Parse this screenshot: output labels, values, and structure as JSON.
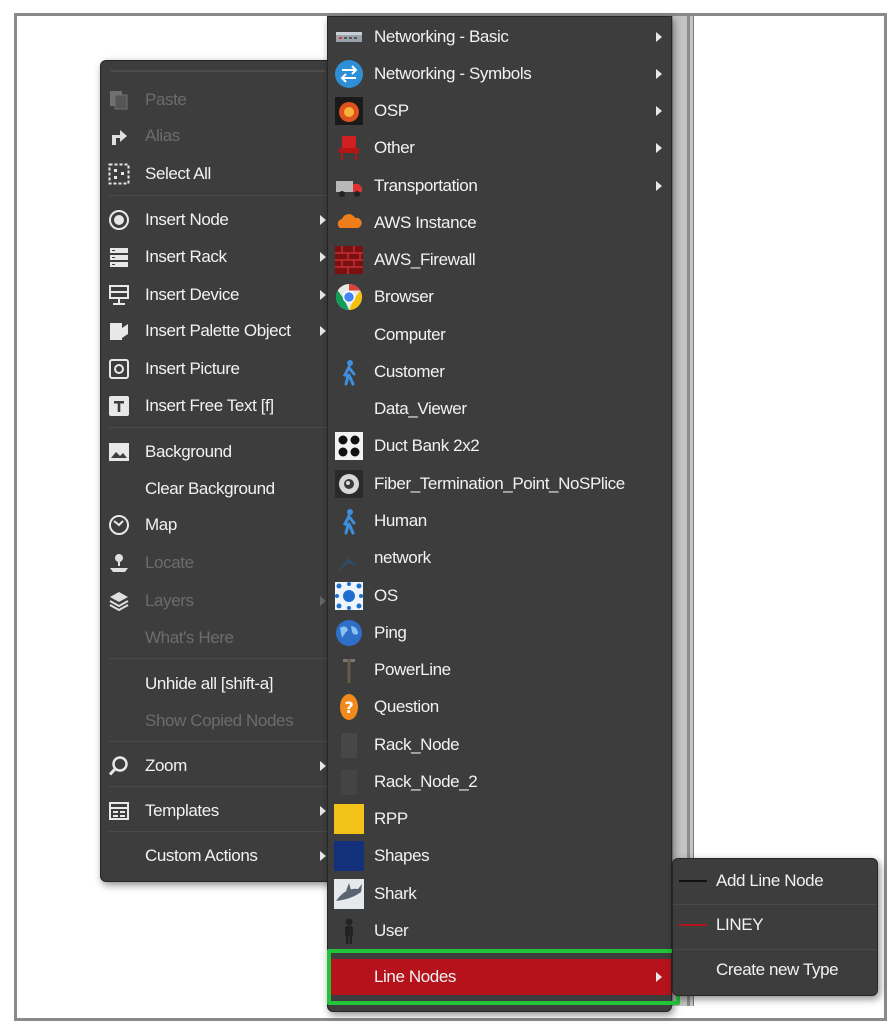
{
  "left_menu": {
    "items": [
      {
        "label": "Paste",
        "icon": "paste-icon",
        "disabled": true
      },
      {
        "label": "Alias",
        "icon": "alias-icon",
        "disabled": true
      },
      {
        "label": "Select All",
        "icon": "select-all-icon"
      },
      {
        "label": "Insert Node",
        "icon": "insert-node-icon",
        "submenu": true
      },
      {
        "label": "Insert Rack",
        "icon": "insert-rack-icon",
        "submenu": true
      },
      {
        "label": "Insert Device",
        "icon": "insert-device-icon",
        "submenu": true
      },
      {
        "label": "Insert Palette Object",
        "icon": "insert-palette-icon",
        "submenu": true
      },
      {
        "label": "Insert Picture",
        "icon": "insert-picture-icon"
      },
      {
        "label": "Insert Free Text [f]",
        "icon": "insert-text-icon"
      },
      {
        "label": "Background",
        "icon": "background-icon"
      },
      {
        "label": "Clear Background",
        "icon": ""
      },
      {
        "label": "Map",
        "icon": "map-icon"
      },
      {
        "label": "Locate",
        "icon": "locate-icon",
        "disabled": true
      },
      {
        "label": "Layers",
        "icon": "layers-icon",
        "disabled": true,
        "submenu": true
      },
      {
        "label": "What's Here",
        "icon": "",
        "disabled": true
      },
      {
        "label": "Unhide all [shift-a]",
        "icon": ""
      },
      {
        "label": "Show Copied Nodes",
        "icon": "",
        "disabled": true
      },
      {
        "label": "Zoom",
        "icon": "zoom-icon",
        "submenu": true
      },
      {
        "label": "Templates",
        "icon": "templates-icon",
        "submenu": true
      },
      {
        "label": "Custom Actions",
        "icon": "",
        "submenu": true
      }
    ]
  },
  "middle_menu": {
    "items": [
      {
        "label": "Networking - Basic",
        "submenu": true
      },
      {
        "label": "Networking - Symbols",
        "submenu": true
      },
      {
        "label": "OSP",
        "submenu": true
      },
      {
        "label": "Other",
        "submenu": true
      },
      {
        "label": "Transportation",
        "submenu": true
      },
      {
        "label": "AWS Instance"
      },
      {
        "label": "AWS_Firewall"
      },
      {
        "label": "Browser"
      },
      {
        "label": "Computer"
      },
      {
        "label": "Customer"
      },
      {
        "label": "Data_Viewer"
      },
      {
        "label": "Duct Bank 2x2"
      },
      {
        "label": "Fiber_Termination_Point_NoSPlice"
      },
      {
        "label": "Human"
      },
      {
        "label": "network"
      },
      {
        "label": "OS"
      },
      {
        "label": "Ping"
      },
      {
        "label": "PowerLine"
      },
      {
        "label": "Question"
      },
      {
        "label": "Rack_Node"
      },
      {
        "label": "Rack_Node_2"
      },
      {
        "label": "RPP"
      },
      {
        "label": "Shapes"
      },
      {
        "label": "Shark"
      },
      {
        "label": "User"
      },
      {
        "label": "Line Nodes",
        "submenu": true,
        "highlighted": true
      }
    ]
  },
  "right_menu": {
    "items": [
      {
        "label": "Add Line Node",
        "line_color": "#111111"
      },
      {
        "label": "LINEY",
        "line_color": "#b5121b"
      },
      {
        "label": "Create new Type",
        "line_color": ""
      }
    ]
  },
  "colors": {
    "menu_bg": "#3d3d3d",
    "highlight": "#b5121b",
    "callout": "#22c23a"
  }
}
